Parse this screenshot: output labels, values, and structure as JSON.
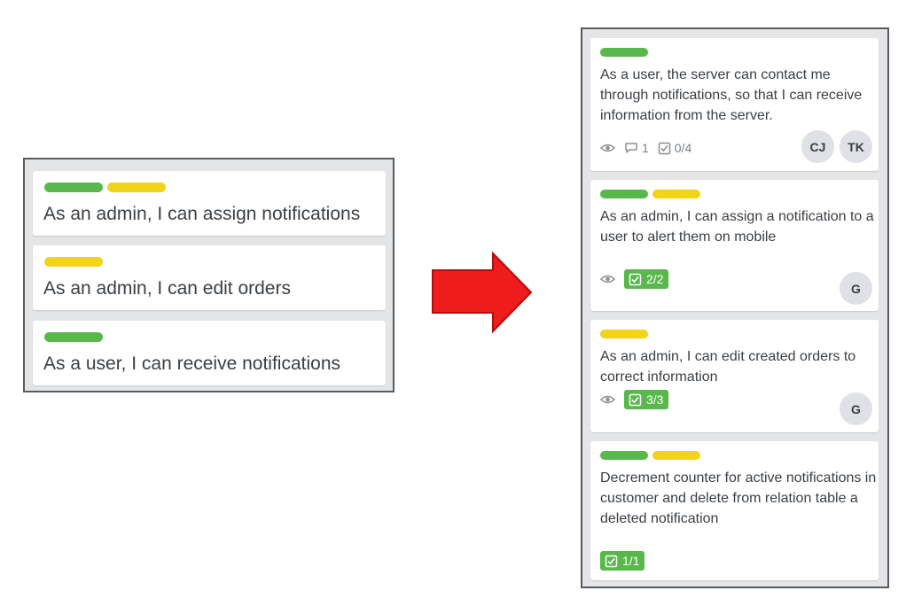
{
  "left_board": {
    "cards": [
      {
        "labels": [
          "green",
          "yellow"
        ],
        "title": "As an admin, I can assign notifications"
      },
      {
        "labels": [
          "yellow"
        ],
        "title": "As an admin, I can edit orders"
      },
      {
        "labels": [
          "green"
        ],
        "title": "As a user, I can receive notifications"
      }
    ]
  },
  "right_board": {
    "cards": [
      {
        "labels": [
          "green"
        ],
        "title": "As a user, the server can contact me through notifications, so that I can receive information from the server.",
        "comments": "1",
        "checklist": "0/4",
        "members": [
          "CJ",
          "TK"
        ]
      },
      {
        "labels": [
          "green",
          "yellow"
        ],
        "title": "As an admin, I can assign a notification to a user to alert them on mobile",
        "checklist": "2/2",
        "members": [
          "G"
        ]
      },
      {
        "labels": [
          "yellow"
        ],
        "title": "As an admin, I can edit created orders to correct information",
        "checklist": "3/3",
        "members": [
          "G"
        ]
      },
      {
        "labels": [
          "green",
          "yellow"
        ],
        "title": "Decrement counter for active notifications in customer and delete from relation table a deleted notification",
        "checklist": "1/1"
      }
    ]
  },
  "colors": {
    "label_green": "#59b84c",
    "label_yellow": "#f1d318",
    "arrow": "#ee1c1c",
    "panel_border": "#585c60",
    "panel_bg": "#e3e5e7"
  },
  "icons": {
    "watch": "eye-icon",
    "comments": "comment-icon",
    "checklist": "checklist-icon",
    "transition": "right-arrow-icon"
  }
}
